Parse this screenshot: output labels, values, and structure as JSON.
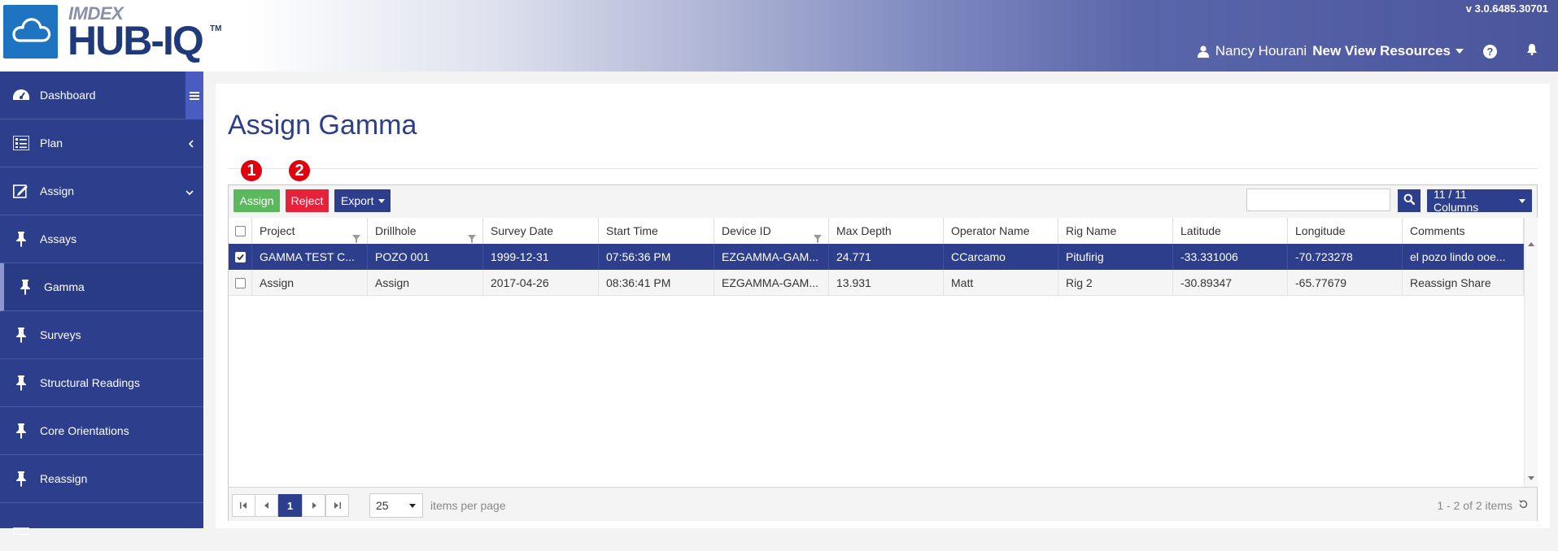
{
  "header": {
    "brand_small": "IMDEX",
    "brand_big": "HUB-IQ",
    "brand_tm": "TM",
    "version": "v 3.0.6485.30701",
    "user_name": "Nancy Hourani",
    "org_name": "New View Resources"
  },
  "sidebar": {
    "items": [
      {
        "label": "Dashboard",
        "icon": "dashboard-icon"
      },
      {
        "label": "Plan",
        "icon": "list-icon"
      },
      {
        "label": "Assign",
        "icon": "edit-icon"
      },
      {
        "label": "Assays",
        "icon": "pin-icon"
      },
      {
        "label": "Gamma",
        "icon": "pin-icon"
      },
      {
        "label": "Surveys",
        "icon": "pin-icon"
      },
      {
        "label": "Structural Readings",
        "icon": "pin-icon"
      },
      {
        "label": "Core Orientations",
        "icon": "pin-icon"
      },
      {
        "label": "Reassign",
        "icon": "pin-icon"
      }
    ]
  },
  "page": {
    "title": "Assign Gamma",
    "badge1": "1",
    "badge2": "2"
  },
  "toolbar": {
    "assign_label": "Assign",
    "reject_label": "Reject",
    "export_label": "Export",
    "search_placeholder": "",
    "columns_label": "11 / 11 Columns"
  },
  "table": {
    "headers": [
      "Project",
      "Drillhole",
      "Survey Date",
      "Start Time",
      "Device ID",
      "Max Depth",
      "Operator Name",
      "Rig Name",
      "Latitude",
      "Longitude",
      "Comments"
    ],
    "rows": [
      {
        "selected": true,
        "cells": [
          "GAMMA TEST C...",
          "POZO 001",
          "1999-12-31",
          "07:56:36 PM",
          "EZGAMMA-GAM...",
          "24.771",
          "CCarcamo",
          "Pitufirig",
          "-33.331006",
          "-70.723278",
          "el pozo lindo ooe..."
        ]
      },
      {
        "selected": false,
        "cells": [
          "Assign",
          "Assign",
          "2017-04-26",
          "08:36:41 PM",
          "EZGAMMA-GAM...",
          "13.931",
          "Matt",
          "Rig 2",
          "-30.89347",
          "-65.77679",
          "Reassign Share"
        ]
      }
    ]
  },
  "pager": {
    "current_page": "1",
    "page_size": "25",
    "items_per_page_label": "items per page",
    "info": "1 - 2 of 2 items"
  },
  "colors": {
    "primary": "#2c3e8c",
    "assign_green": "#5cb85c",
    "reject_red": "#e8213b",
    "badge_red": "#e0000d"
  }
}
